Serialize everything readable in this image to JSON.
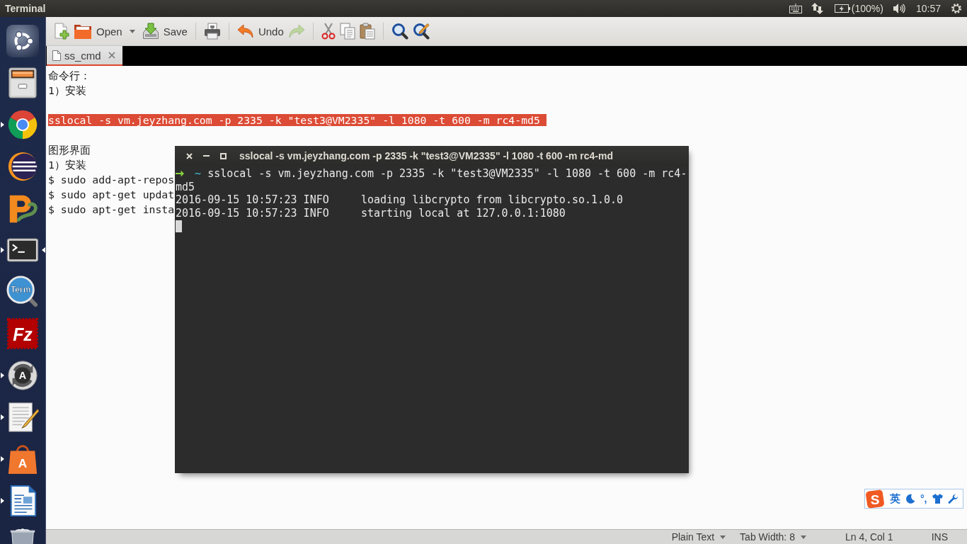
{
  "top_panel": {
    "app_title": "Terminal",
    "battery": "(100%)",
    "clock": "10:57"
  },
  "launcher": {
    "items": [
      {
        "running": false,
        "focused": false
      },
      {
        "running": false,
        "focused": false
      },
      {
        "running": true,
        "focused": false
      },
      {
        "running": false,
        "focused": false
      },
      {
        "running": false,
        "focused": false
      },
      {
        "running": true,
        "focused": true
      },
      {
        "running": false,
        "focused": false,
        "logo_text": "Term"
      },
      {
        "running": false,
        "focused": false,
        "logo_text": "Fz"
      },
      {
        "running": true,
        "focused": false,
        "logo_text": "A"
      },
      {
        "running": true,
        "focused": false
      },
      {
        "running": true,
        "focused": false,
        "logo_text": "A"
      },
      {
        "running": true,
        "focused": false
      },
      {
        "running": false,
        "focused": false
      }
    ]
  },
  "toolbar": {
    "groups": [
      {
        "buttons": [
          {
            "disabled": false
          },
          {
            "label": "Open",
            "disabled": false,
            "dropdown": true
          },
          {
            "label": "Save",
            "disabled": false
          }
        ]
      },
      {
        "buttons": [
          {
            "disabled": false
          }
        ]
      },
      {
        "buttons": [
          {
            "label": "Undo",
            "disabled": false
          },
          {
            "disabled": true
          }
        ]
      },
      {
        "buttons": [
          {
            "disabled": false
          },
          {
            "disabled": false
          },
          {
            "disabled": false
          }
        ]
      },
      {
        "buttons": [
          {
            "disabled": false
          },
          {
            "disabled": false
          }
        ]
      }
    ]
  },
  "tabs": [
    {
      "label": "ss_cmd",
      "selected": true
    }
  ],
  "editor": {
    "blocks": [
      {
        "lines": [
          {
            "text": "命令行：",
            "selected": false
          },
          {
            "text": "1）安装",
            "selected": false
          }
        ]
      },
      {
        "lines": [
          {
            "text": "sslocal -s vm.jeyzhang.com -p 2335 -k \"test3@VM2335\" -l 1080 -t 600 -m rc4-md5",
            "selected": true
          }
        ]
      },
      {
        "lines": [
          {
            "text": "图形界面",
            "selected": false
          },
          {
            "text": "1）安装",
            "selected": false
          },
          {
            "text": "$ sudo add-apt-repos",
            "selected": false
          },
          {
            "text": "$ sudo apt-get updat",
            "selected": false
          },
          {
            "text": "$ sudo apt-get insta",
            "selected": false
          }
        ]
      }
    ]
  },
  "status_bar": {
    "items": [
      {
        "label": "Plain Text",
        "dropdown": true
      },
      {
        "label": "Tab Width: 8",
        "dropdown": true
      },
      {
        "label": "Ln 4, Col 1",
        "dropdown": false
      },
      {
        "label": "INS",
        "dropdown": false
      }
    ]
  },
  "terminal": {
    "title": "sslocal -s vm.jeyzhang.com -p 2335 -k \"test3@VM2335\" -l 1080 -t 600 -m rc4-md",
    "prompt_path": "~",
    "command": "sslocal -s vm.jeyzhang.com -p 2335 -k \"test3@VM2335\" -l 1080 -t 600 -m rc4-md5",
    "output": [
      "2016-09-15 10:57:23 INFO     loading libcrypto from libcrypto.so.1.0.0",
      "2016-09-15 10:57:23 INFO     starting local at 127.0.0.1:1080"
    ]
  },
  "ime_bar": {
    "logo_text": "S",
    "mode": "英",
    "punctuation": "°,"
  }
}
